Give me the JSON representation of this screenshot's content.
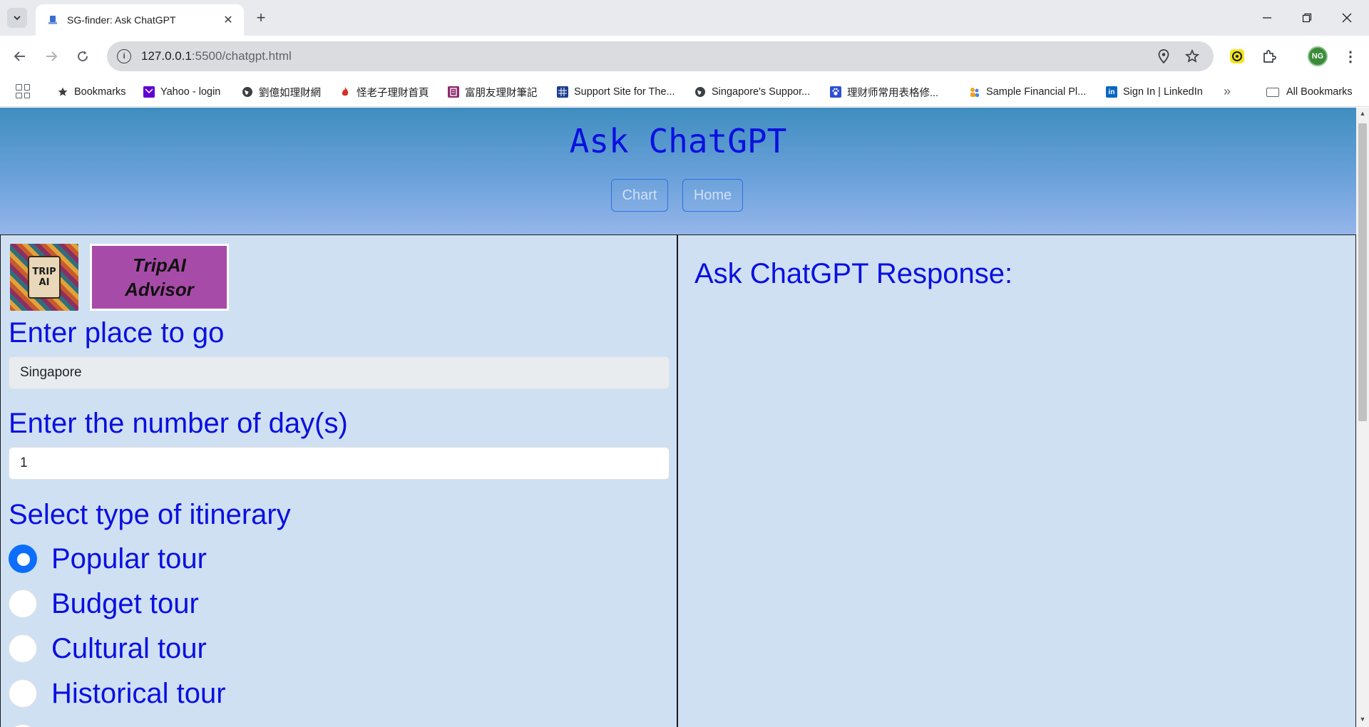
{
  "browser": {
    "tab_title": "SG-finder: Ask ChatGPT",
    "tab_list_icon": "chevron-down-icon",
    "tab_close_glyph": "✕",
    "new_tab_glyph": "+",
    "url_host": "127.0.0.1",
    "url_path": ":5500/chatgpt.html",
    "profile_initials": "NG",
    "bookmarks": [
      {
        "label": "Bookmarks",
        "icon": "star-icon",
        "color": "#3c4043"
      },
      {
        "label": "Yahoo - login",
        "icon": "yahoo-mail-icon",
        "color": "#6001d2"
      },
      {
        "label": "劉億如理財網",
        "icon": "globe-icon",
        "color": "#3c4043"
      },
      {
        "label": "怪老子理財首頁",
        "icon": "fire-icon",
        "color": "#d93025"
      },
      {
        "label": "富朋友理財筆記",
        "icon": "notebook-icon",
        "color": "#8e2a6e"
      },
      {
        "label": "Support Site for The...",
        "icon": "grid-icon",
        "color": "#1a3d8f"
      },
      {
        "label": "Singapore's Suppor...",
        "icon": "globe-icon",
        "color": "#3c4043"
      },
      {
        "label": "理财师常用表格修...",
        "icon": "paw-icon",
        "color": "#2e4fd6"
      },
      {
        "label": "Sample Financial Pl...",
        "icon": "people-icon",
        "color": "#f4a21b"
      },
      {
        "label": "Sign In | LinkedIn",
        "icon": "linkedin-icon",
        "color": "#0a66c2"
      }
    ],
    "bookmarks_overflow": "»",
    "all_bookmarks": "All Bookmarks"
  },
  "page": {
    "title": "Ask ChatGPT",
    "nav": {
      "chart": "Chart",
      "home": "Home"
    },
    "logo_text_1": "TRIP",
    "logo_text_2": "AI",
    "brand_line_1": "TripAI",
    "brand_line_2": "Advisor",
    "place_label": "Enter place to go",
    "place_value": "Singapore",
    "days_label": "Enter the number of day(s)",
    "days_value": "1",
    "itinerary_label": "Select type of itinerary",
    "itinerary_options": [
      {
        "label": "Popular tour",
        "checked": true
      },
      {
        "label": "Budget tour",
        "checked": false
      },
      {
        "label": "Cultural tour",
        "checked": false
      },
      {
        "label": "Historical tour",
        "checked": false
      }
    ],
    "response_title": "Ask ChatGPT Response:"
  },
  "colors": {
    "accent_text": "#0a10e0",
    "radio_checked": "#0d6efd",
    "panel_bg": "#cfe0f3",
    "brand_bg": "#a74ba8"
  }
}
